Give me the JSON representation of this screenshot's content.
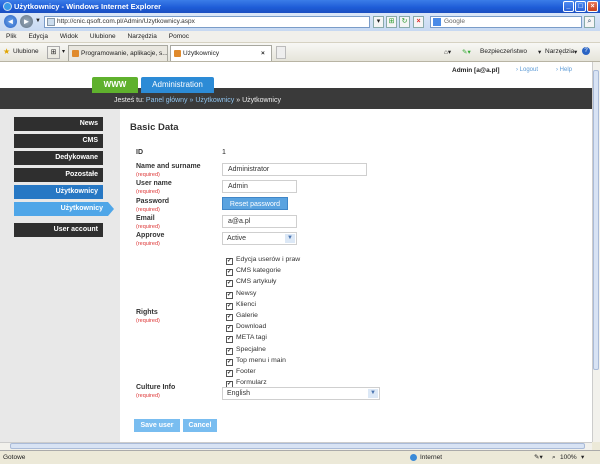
{
  "window": {
    "title": "Użytkownicy - Windows Internet Explorer"
  },
  "address": {
    "url": "http://cnic.qsoft.com.pl/Admin/Uzytkownicy.aspx",
    "search_placeholder": "Google"
  },
  "menu": [
    "Plik",
    "Edycja",
    "Widok",
    "Ulubione",
    "Narzędzia",
    "Pomoc"
  ],
  "favorites": {
    "label": "Ulubione",
    "tabs": [
      {
        "label": "Programowanie, aplikacje, s..."
      },
      {
        "label": "Użytkownicy"
      }
    ],
    "commands": [
      "Bezpieczeństwo",
      "Narzędzia"
    ]
  },
  "header": {
    "www": "WWW",
    "administration": "Administration",
    "user": "Admin [a@a.pl]",
    "logout": "› Logout",
    "help": "› Help",
    "breadcrumb_prefix": "Jesteś tu:",
    "breadcrumb": [
      "Panel główny",
      "Użytkownicy",
      "Użytkownicy"
    ],
    "breadcrumb_sep": "»"
  },
  "sidebar": {
    "items": [
      "News",
      "CMS",
      "Dedykowane",
      "Pozostałe",
      "Użytkownicy"
    ],
    "sub_item": "Użytkownicy",
    "account": "User account"
  },
  "form": {
    "heading": "Basic Data",
    "required": "(required)",
    "id_label": "ID",
    "id_value": "1",
    "name_label": "Name and surname",
    "name_value": "Administrator",
    "username_label": "User name",
    "username_value": "Admin",
    "password_label": "Password",
    "reset_label": "Reset password",
    "email_label": "Email",
    "email_value": "a@a.pl",
    "approve_label": "Approve",
    "approve_value": "Active",
    "rights_label": "Rights",
    "rights": [
      "Edycja userów i praw",
      "CMS kategorie",
      "CMS artykuły",
      "Newsy",
      "Klienci",
      "Galerie",
      "Download",
      "META tagi",
      "Specjalne",
      "Top menu i main",
      "Footer",
      "Formularz"
    ],
    "culture_label": "Culture Info",
    "culture_value": "English",
    "save": "Save user",
    "cancel": "Cancel"
  },
  "status": {
    "left": "Gotowe",
    "zone": "Internet",
    "zoom": "100%"
  }
}
